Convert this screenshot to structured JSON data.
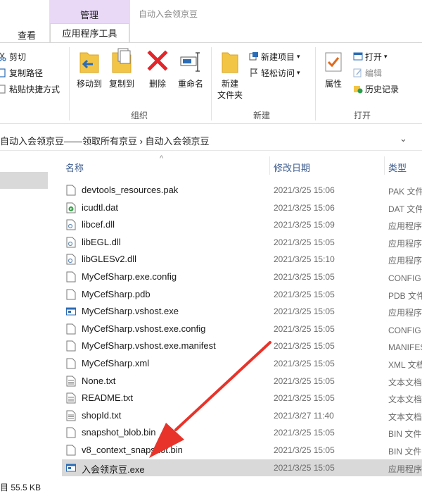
{
  "tabs": {
    "manage": "管理",
    "view": "查看",
    "app_tools": "应用程序工具",
    "window_title": "自动入会领京豆"
  },
  "ribbon": {
    "clipboard": {
      "cut": "剪切",
      "copy_path": "复制路径",
      "paste_shortcut": "粘贴快捷方式"
    },
    "organize": {
      "move_to": "移动到",
      "copy_to": "复制到",
      "delete": "删除",
      "rename": "重命名",
      "group_label": "组织"
    },
    "new": {
      "new_folder_line1": "新建",
      "new_folder_line2": "文件夹",
      "new_item": "新建项目",
      "easy_access": "轻松访问",
      "group_label": "新建"
    },
    "open": {
      "properties": "属性",
      "open": "打开",
      "edit": "编辑",
      "history": "历史记录",
      "group_label": "打开"
    }
  },
  "address": {
    "path": "自动入会领京豆——领取所有京豆 › 自动入会领京豆"
  },
  "columns": {
    "name": "名称",
    "modified": "修改日期",
    "type": "类型"
  },
  "files": [
    {
      "name": "devtools_resources.pak",
      "date": "2021/3/25 15:06",
      "type": "PAK 文件",
      "icon": "blank-file-icon"
    },
    {
      "name": "icudtl.dat",
      "date": "2021/3/25 15:06",
      "type": "DAT 文件",
      "icon": "media-file-icon"
    },
    {
      "name": "libcef.dll",
      "date": "2021/3/25 15:09",
      "type": "应用程序扩展",
      "icon": "dll-file-icon"
    },
    {
      "name": "libEGL.dll",
      "date": "2021/3/25 15:05",
      "type": "应用程序扩展",
      "icon": "dll-file-icon"
    },
    {
      "name": "libGLESv2.dll",
      "date": "2021/3/25 15:10",
      "type": "应用程序扩展",
      "icon": "dll-file-icon"
    },
    {
      "name": "MyCefSharp.exe.config",
      "date": "2021/3/25 15:05",
      "type": "CONFIG 文件",
      "icon": "blank-file-icon"
    },
    {
      "name": "MyCefSharp.pdb",
      "date": "2021/3/25 15:05",
      "type": "PDB 文件",
      "icon": "blank-file-icon"
    },
    {
      "name": "MyCefSharp.vshost.exe",
      "date": "2021/3/25 15:05",
      "type": "应用程序",
      "icon": "exe-file-icon"
    },
    {
      "name": "MyCefSharp.vshost.exe.config",
      "date": "2021/3/25 15:05",
      "type": "CONFIG 文件",
      "icon": "blank-file-icon"
    },
    {
      "name": "MyCefSharp.vshost.exe.manifest",
      "date": "2021/3/25 15:05",
      "type": "MANIFEST 文件",
      "icon": "blank-file-icon"
    },
    {
      "name": "MyCefSharp.xml",
      "date": "2021/3/25 15:05",
      "type": "XML 文档",
      "icon": "blank-file-icon"
    },
    {
      "name": "None.txt",
      "date": "2021/3/25 15:05",
      "type": "文本文档",
      "icon": "text-file-icon"
    },
    {
      "name": "README.txt",
      "date": "2021/3/25 15:05",
      "type": "文本文档",
      "icon": "text-file-icon"
    },
    {
      "name": "shopId.txt",
      "date": "2021/3/27 11:40",
      "type": "文本文档",
      "icon": "text-file-icon"
    },
    {
      "name": "snapshot_blob.bin",
      "date": "2021/3/25 15:05",
      "type": "BIN 文件",
      "icon": "blank-file-icon"
    },
    {
      "name": "v8_context_snapshot.bin",
      "date": "2021/3/25 15:05",
      "type": "BIN 文件",
      "icon": "blank-file-icon"
    },
    {
      "name": "入会领京豆.exe",
      "date": "2021/3/25 15:05",
      "type": "应用程序",
      "icon": "exe-file-icon",
      "selected": true
    }
  ],
  "status": {
    "text": "目 55.5 KB"
  },
  "colors": {
    "manage_tab": "#e9d9f7",
    "selected_row": "#d9d9d9",
    "arrow": "#e8332a",
    "header_text": "#3a5a8c"
  }
}
